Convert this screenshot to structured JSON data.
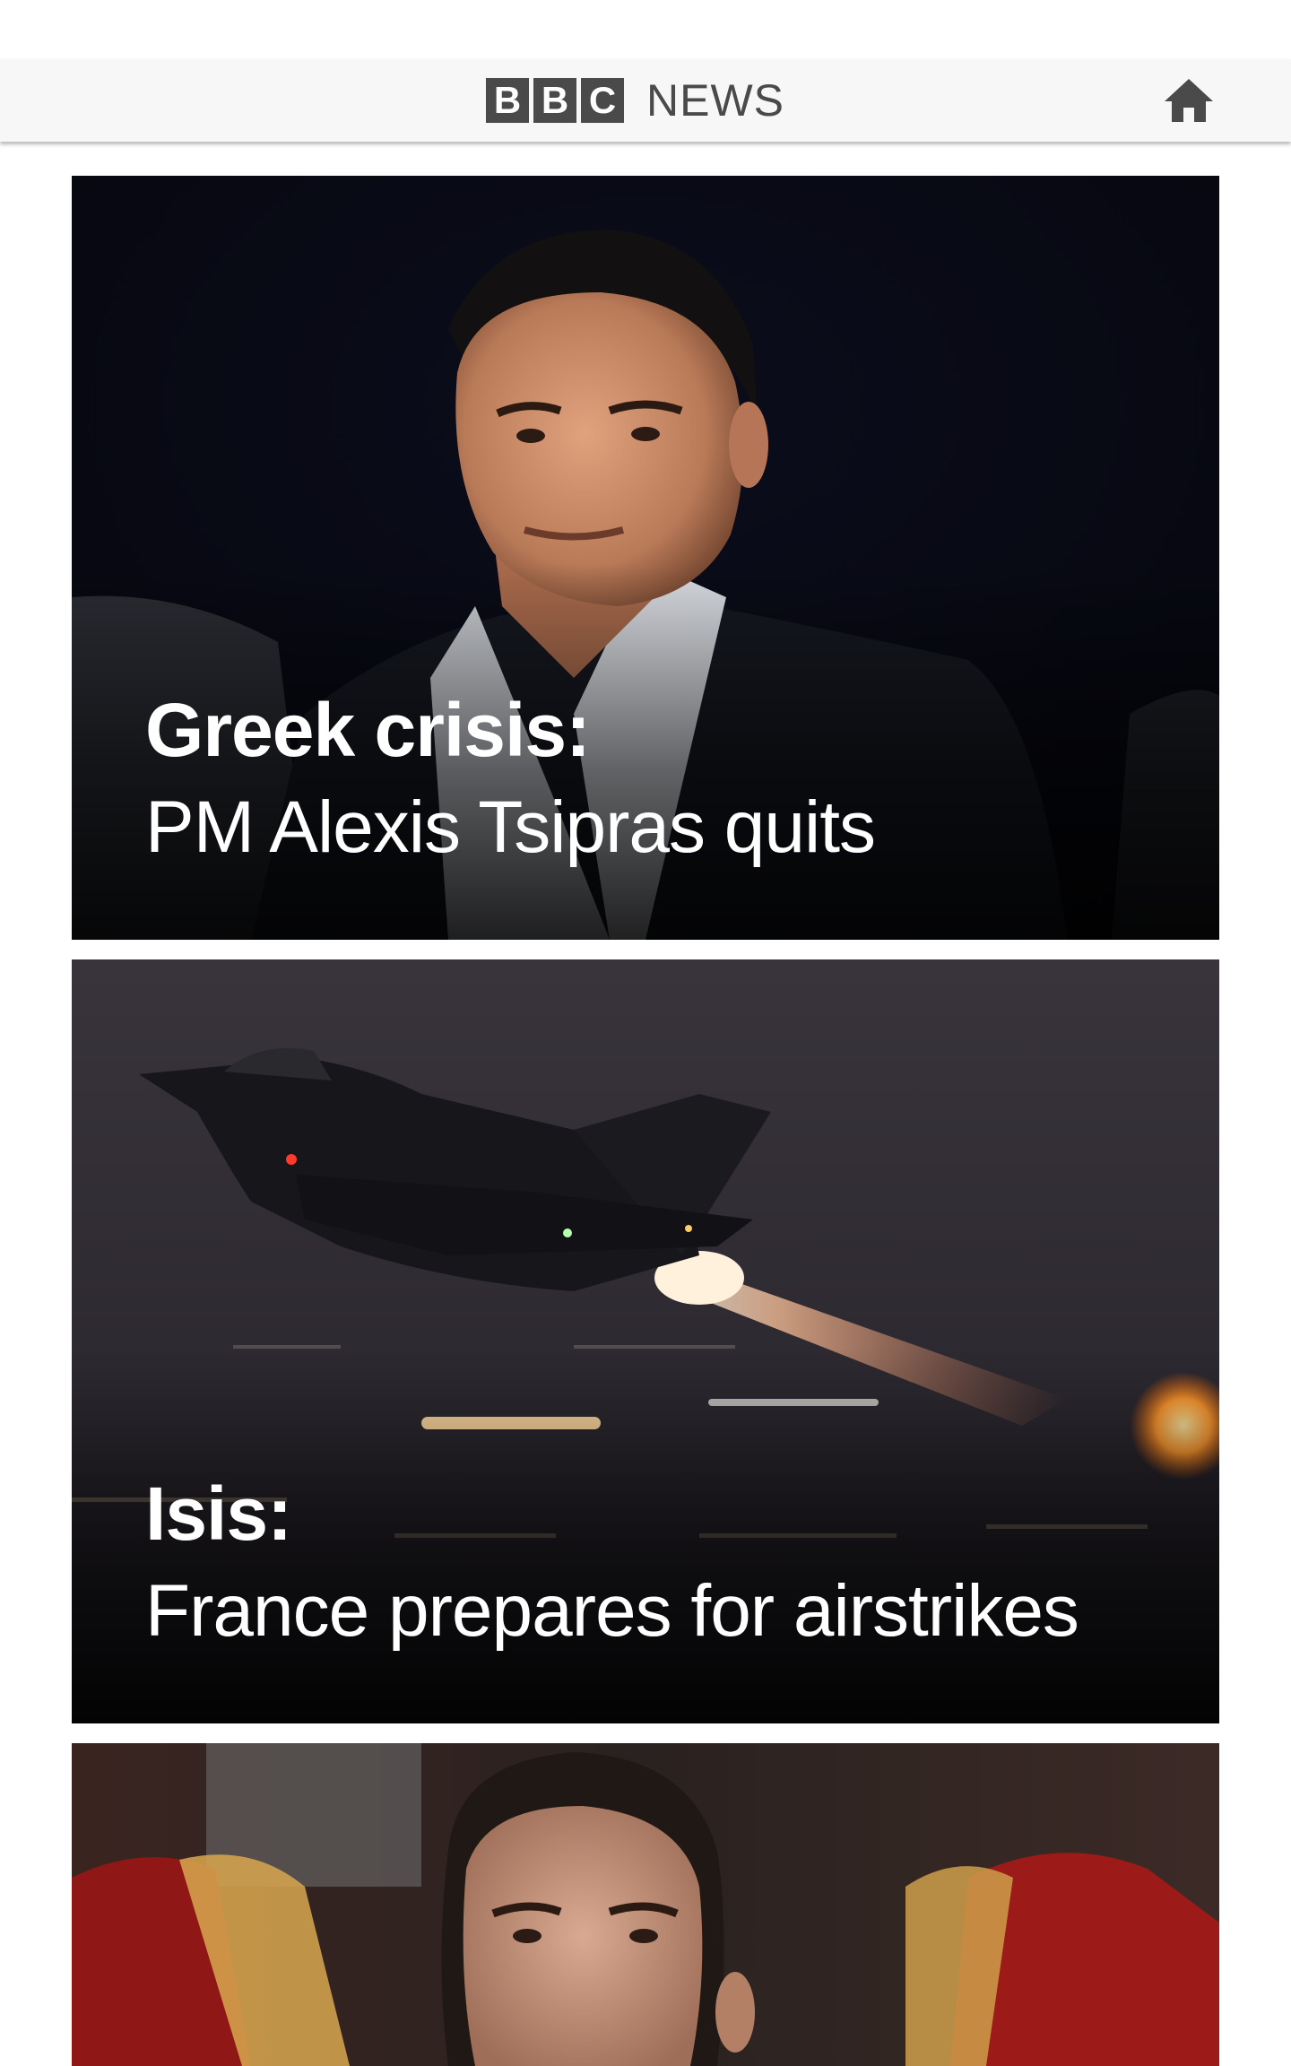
{
  "header": {
    "logo_letters": [
      "B",
      "B",
      "C"
    ],
    "logo_word": "NEWS",
    "home_icon": "home-icon",
    "background": "#f7f7f7",
    "logo_color": "#4a4a4a"
  },
  "stories": [
    {
      "topic": "Greek crisis:",
      "headline": "PM Alexis Tsipras quits",
      "image": "photo-man-in-suit-night"
    },
    {
      "topic": "Isis:",
      "headline": "France prepares for airstrikes",
      "image": "photo-fighter-jet-takeoff-night"
    },
    {
      "image": "photo-man-portrait-red-seats"
    }
  ]
}
